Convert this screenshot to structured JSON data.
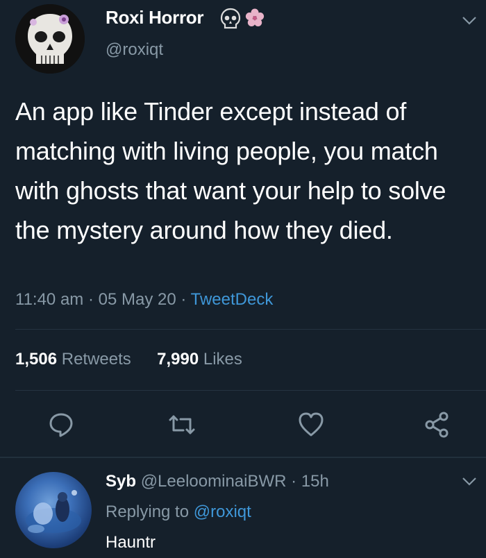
{
  "tweet": {
    "author": {
      "name": "Roxi Horror",
      "handle": "@roxiqt",
      "name_emojis": [
        "skull-icon",
        "cherry-blossom-icon"
      ],
      "avatar": "skull-avatar"
    },
    "text": "An app like Tinder except instead of matching with living people, you match with ghosts that want your help to solve the mystery around how they died.",
    "time": "11:40 am",
    "date": "05 May 20",
    "source": "TweetDeck",
    "separator": "·",
    "stats": {
      "retweets_count": "1,506",
      "retweets_label": "Retweets",
      "likes_count": "7,990",
      "likes_label": "Likes"
    },
    "actions": [
      "reply-icon",
      "retweet-icon",
      "like-icon",
      "share-icon"
    ]
  },
  "reply": {
    "name": "Syb",
    "handle": "@LeeloominaiBWR",
    "separator": "·",
    "time": "15h",
    "replying_prefix": "Replying to",
    "replying_to": "@roxiqt",
    "text": "Hauntr"
  },
  "colors": {
    "background": "#15202b",
    "text_primary": "#ffffff",
    "text_secondary": "#8899a6",
    "link": "#3f97d8",
    "divider": "#253341"
  }
}
